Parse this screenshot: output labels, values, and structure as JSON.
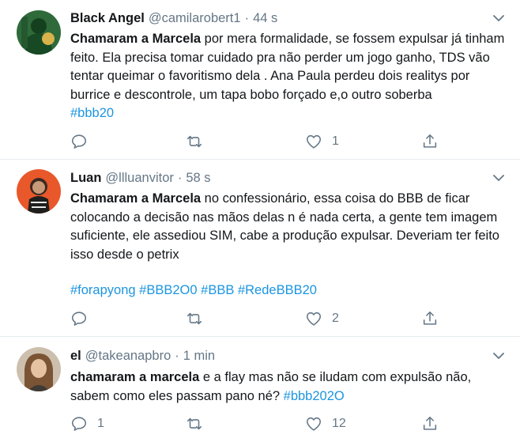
{
  "tweets": [
    {
      "name": "Black Angel",
      "handle": "@camilarobert1",
      "dot": "·",
      "time": "44 s",
      "bold": "Chamaram a Marcela",
      "text": " por mera formalidade, se fossem expulsar já tinham feito. Ela precisa tomar cuidado pra não perder um jogo ganho, TDS vão tentar queimar o favoritismo dela . Ana Paula perdeu dois realitys por burrice e descontrole, um tapa bobo forçado e,o outro soberba",
      "hashtags": [
        "#bbb20"
      ],
      "replies": "",
      "retweets": "",
      "likes": "1",
      "avatar_color": "#1c5a2c"
    },
    {
      "name": "Luan",
      "handle": "@llluanvitor",
      "dot": "·",
      "time": "58 s",
      "bold": "Chamaram a Marcela",
      "text": " no confessionário, essa coisa do BBB de ficar colocando a decisão nas mãos delas n é nada certa, a gente tem imagem suficiente, ele assediou SIM, cabe a produção expulsar. Deveriam ter feito isso desde o petrix",
      "hashtags": [
        "#forapyong",
        "#BBB2O0",
        "#BBB",
        "#RedeBBB20"
      ],
      "replies": "",
      "retweets": "",
      "likes": "2",
      "avatar_color": "#e25a2a"
    },
    {
      "name": "el",
      "handle": "@takeanapbro",
      "dot": "·",
      "time": "1 min",
      "bold": "chamaram a marcela",
      "text": " e a flay mas não se iludam com expulsão não, sabem como eles passam pano né? ",
      "hashtags": [
        "#bbb202O"
      ],
      "replies": "1",
      "retweets": "",
      "likes": "12",
      "avatar_color": "#8a6a4a"
    }
  ],
  "icons": {
    "reply": "reply-icon",
    "retweet": "retweet-icon",
    "like": "heart-icon",
    "share": "share-icon",
    "caret": "chevron-down-icon"
  },
  "colors": {
    "text": "#14171a",
    "secondary": "#657786",
    "link": "#1b95e0",
    "divider": "#e6ecf0"
  }
}
